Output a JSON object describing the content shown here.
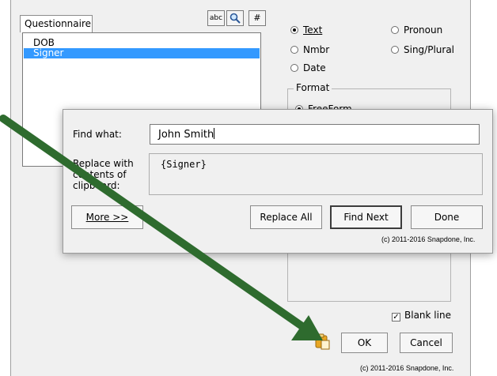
{
  "questionnaire": {
    "tab_label": "Questionnaire",
    "toolbar": {
      "abc_label": "abc",
      "hash_label": "#"
    },
    "items": [
      "DOB",
      "Signer"
    ]
  },
  "type_options": {
    "text": "Text",
    "pronoun": "Pronoun",
    "nmbr": "Nmbr",
    "sing_plural": "Sing/Plural",
    "date": "Date",
    "selected": "Text"
  },
  "format": {
    "legend": "Format",
    "freeform": "FreeForm",
    "selected": "FreeForm"
  },
  "blank_line": {
    "label": "Blank line",
    "checked": true
  },
  "buttons": {
    "ok": "OK",
    "cancel": "Cancel"
  },
  "copyright_main": "(c) 2011-2016 Snapdone, Inc.",
  "find_dialog": {
    "find_what_label": "Find what:",
    "find_what_value": "John Smith",
    "replace_label_lines": [
      "Replace with",
      "contents of",
      "clipboard:"
    ],
    "replace_value": "{Signer}",
    "more_button": "More >>",
    "replace_all_button": "Replace All",
    "find_next_button": "Find Next",
    "done_button": "Done",
    "copyright": "(c) 2011-2016 Snapdone, Inc."
  },
  "colors": {
    "selection": "#3399ff",
    "arrow": "#2e6b2e"
  }
}
